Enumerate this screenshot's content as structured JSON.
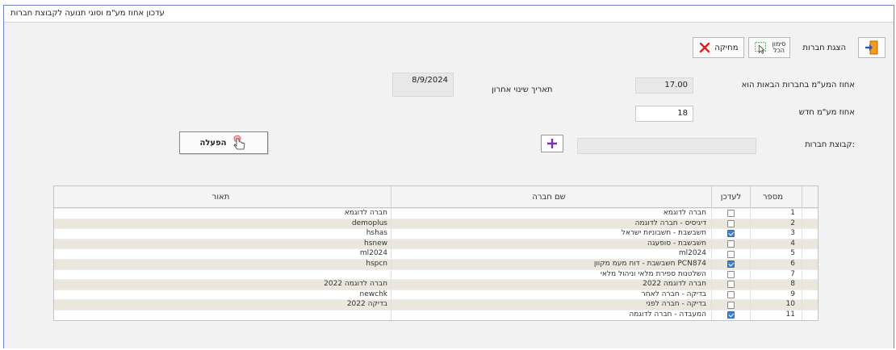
{
  "window": {
    "title": "עדכון אחוז מע\"מ וסוגי תנועה לקבוצת חברות"
  },
  "toolbar": {
    "show_companies": "הצגת חברות",
    "select_all_line1": "סימון",
    "select_all_line2": "הכל",
    "delete": "מחיקה"
  },
  "form": {
    "vat_label": "אחוז המע\"מ בחברות הבאות הוא",
    "vat_value": "17.00",
    "last_change_label": "תאריך שינוי אחרון",
    "last_change_value": "8/9/2024",
    "new_vat_label": "אחוז מע\"מ חדש",
    "new_vat_value": "18",
    "group_label": "קבוצת חברות:",
    "group_value": "",
    "run_button": "הפעלה"
  },
  "table": {
    "headers": {
      "number": "מספר",
      "update": "לעדכן",
      "company_name": "שם חברה",
      "description": "תאור"
    },
    "rows": [
      {
        "number": "1",
        "update": false,
        "company_name": "חברה לדוגמא",
        "description": "חברה לדוגמא"
      },
      {
        "number": "2",
        "update": false,
        "company_name": "דיגיסיס - חברה לדוגמה",
        "description": "demoplus"
      },
      {
        "number": "3",
        "update": true,
        "company_name": "חשבשבת - חשבוניות ישראל",
        "description": "hshas"
      },
      {
        "number": "4",
        "update": false,
        "company_name": "חשבשבת - סופעגה",
        "description": "hsnew"
      },
      {
        "number": "5",
        "update": false,
        "company_name": "ml2024",
        "description": "ml2024"
      },
      {
        "number": "6",
        "update": true,
        "company_name": "חשבשבת - דוח מעמ מקוון PCN874",
        "description": "hspcn"
      },
      {
        "number": "7",
        "update": false,
        "company_name": "השלטנות ספירת מלאי וניהול מלאי",
        "description": ""
      },
      {
        "number": "8",
        "update": false,
        "company_name": "חברה לדוגמה 2022",
        "description": "חברה לדוגמה 2022"
      },
      {
        "number": "9",
        "update": false,
        "company_name": "בדיקה - חברה לאחר",
        "description": "newchk"
      },
      {
        "number": "10",
        "update": false,
        "company_name": "בדיקה - חברה לפני",
        "description": "בדיקה 2022"
      },
      {
        "number": "11",
        "update": true,
        "company_name": "המעבדה - חברה לדוגמה",
        "description": ""
      }
    ]
  },
  "colors": {
    "window_border": "#6a86c8",
    "alt_row": "#ebe7dc",
    "checked": "#3f7fd6",
    "delete_icon": "#e02020",
    "plus_icon": "#7b2fbf"
  },
  "icons": {
    "exit": "exit-door-icon",
    "select_all": "select-all-cursor-icon",
    "delete": "red-x-icon",
    "plus": "plus-icon",
    "run": "hand-pointer-icon"
  }
}
